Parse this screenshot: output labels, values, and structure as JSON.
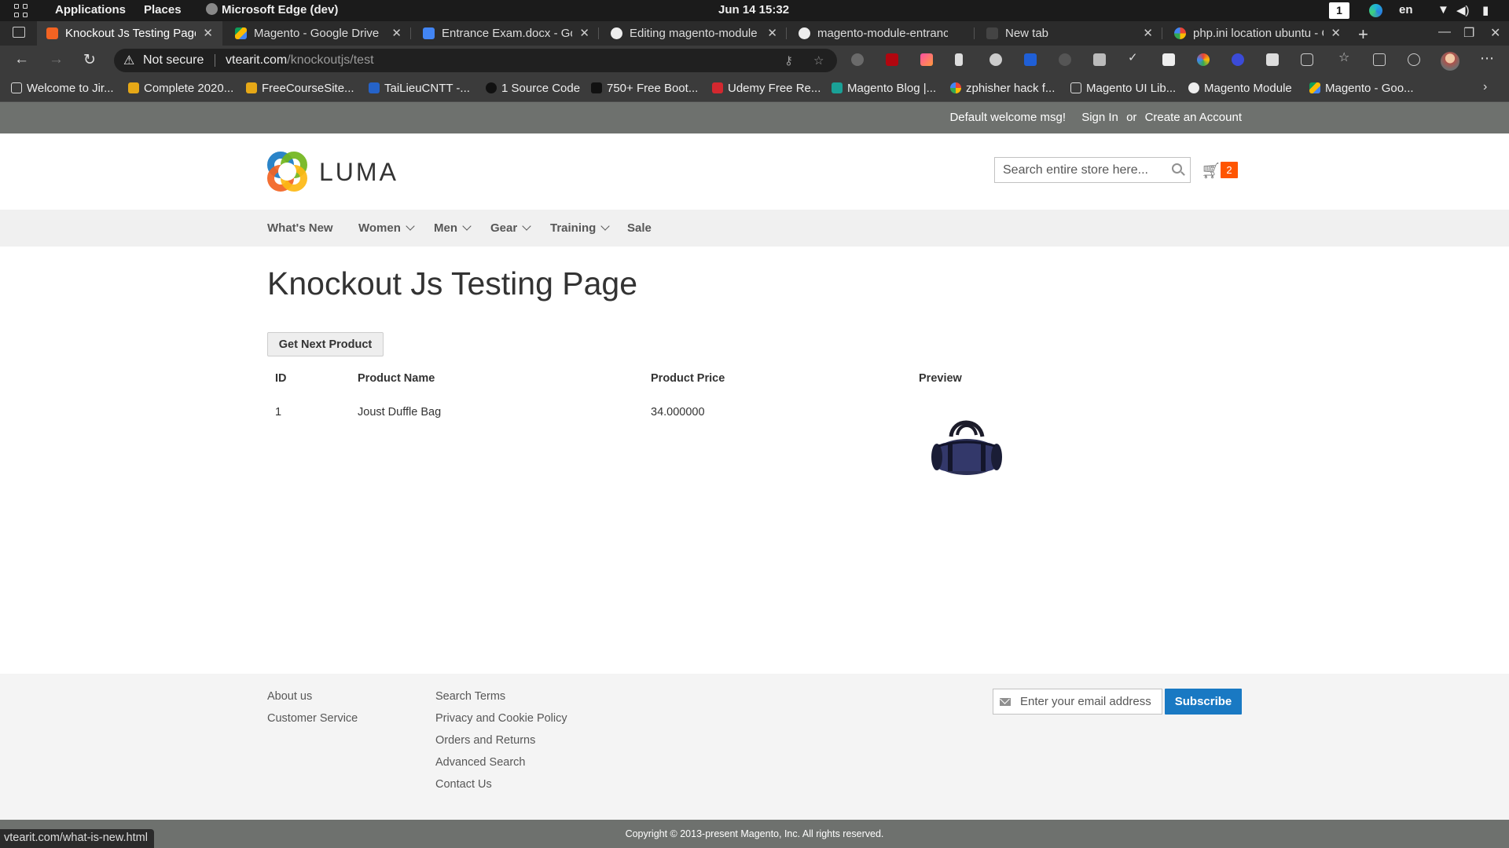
{
  "os_bar": {
    "applications": "Applications",
    "places": "Places",
    "active_app": "Microsoft Edge (dev)",
    "clock": "Jun 14  15:32",
    "workspace": "1",
    "language": "en"
  },
  "tabs": [
    {
      "label": "Knockout Js Testing Page",
      "active": true
    },
    {
      "label": "Magento - Google Drive"
    },
    {
      "label": "Entrance Exam.docx - Go"
    },
    {
      "label": "Editing magento-module"
    },
    {
      "label": "magento-module-entranc"
    },
    {
      "label": "New tab"
    },
    {
      "label": "php.ini location ubuntu - C"
    }
  ],
  "address": {
    "security": "Not secure",
    "host": "vtearit.com",
    "path": "/knockoutjs/test"
  },
  "bookmarks": [
    "Welcome to Jir...",
    "Complete 2020...",
    "FreeCourseSite...",
    "TaiLieuCNTT -...",
    "1 Source Code",
    "750+ Free Boot...",
    "Udemy Free Re...",
    "Magento Blog |...",
    "zphisher hack f...",
    "Magento UI Lib...",
    "Magento Module",
    "Magento - Goo..."
  ],
  "panel": {
    "welcome": "Default welcome msg!",
    "sign_in": "Sign In",
    "or": "or",
    "create_account": "Create an Account"
  },
  "header": {
    "logo_text": "LUMA",
    "search_placeholder": "Search entire store here...",
    "cart_count": "2"
  },
  "nav": [
    {
      "label": "What's New",
      "dropdown": false
    },
    {
      "label": "Women",
      "dropdown": true
    },
    {
      "label": "Men",
      "dropdown": true
    },
    {
      "label": "Gear",
      "dropdown": true
    },
    {
      "label": "Training",
      "dropdown": true
    },
    {
      "label": "Sale",
      "dropdown": false
    }
  ],
  "main": {
    "title": "Knockout Js Testing Page",
    "next_button": "Get Next Product",
    "table": {
      "headers": [
        "ID",
        "Product Name",
        "Product Price",
        "Preview"
      ],
      "rows": [
        {
          "id": "1",
          "name": "Joust Duffle Bag",
          "price": "34.000000"
        }
      ]
    }
  },
  "footer": {
    "col1": [
      "About us",
      "Customer Service"
    ],
    "col2": [
      "Search Terms",
      "Privacy and Cookie Policy",
      "Orders and Returns",
      "Advanced Search",
      "Contact Us"
    ],
    "newsletter_placeholder": "Enter your email address",
    "subscribe": "Subscribe",
    "copyright": "Copyright © 2013-present Magento, Inc. All rights reserved."
  },
  "status_url": "vtearit.com/what-is-new.html",
  "colors": {
    "luma_orange": "#ff5501",
    "subscribe_blue": "#1979c3",
    "panel_gray": "#6e716e"
  }
}
